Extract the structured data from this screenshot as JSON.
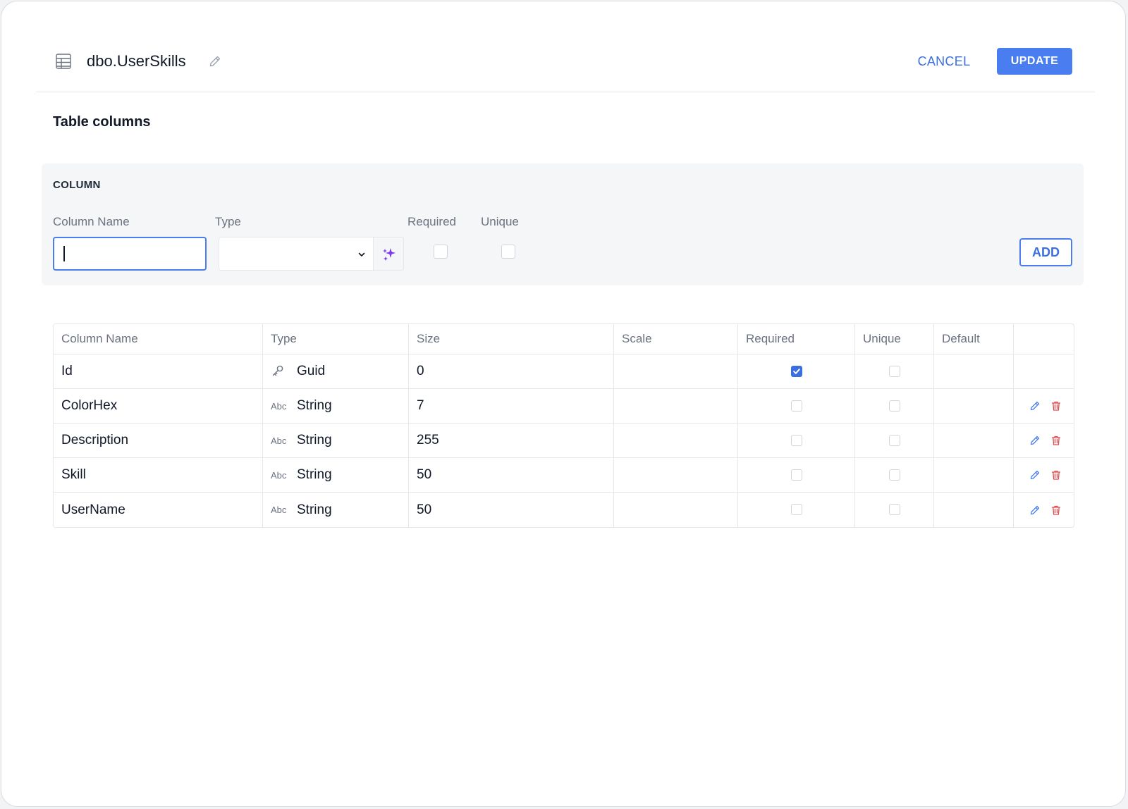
{
  "header": {
    "table_name": "dbo.UserSkills",
    "cancel_label": "CANCEL",
    "update_label": "UPDATE"
  },
  "section_title": "Table columns",
  "add_panel": {
    "heading": "COLUMN",
    "name_label": "Column Name",
    "name_value": "",
    "type_label": "Type",
    "type_value": "",
    "required_label": "Required",
    "unique_label": "Unique",
    "add_label": "ADD"
  },
  "table": {
    "headers": [
      "Column Name",
      "Type",
      "Size",
      "Scale",
      "Required",
      "Unique",
      "Default",
      ""
    ],
    "rows": [
      {
        "name": "Id",
        "type_icon": "key-icon",
        "type": "Guid",
        "size": "0",
        "scale": "",
        "required": true,
        "unique": false,
        "default": "",
        "actions": false
      },
      {
        "name": "ColorHex",
        "type_icon": "abc-icon",
        "type": "String",
        "size": "7",
        "scale": "",
        "required": false,
        "unique": false,
        "default": "",
        "actions": true
      },
      {
        "name": "Description",
        "type_icon": "abc-icon",
        "type": "String",
        "size": "255",
        "scale": "",
        "required": false,
        "unique": false,
        "default": "",
        "actions": true
      },
      {
        "name": "Skill",
        "type_icon": "abc-icon",
        "type": "String",
        "size": "50",
        "scale": "",
        "required": false,
        "unique": false,
        "default": "",
        "actions": true
      },
      {
        "name": "UserName",
        "type_icon": "abc-icon",
        "type": "String",
        "size": "50",
        "scale": "",
        "required": false,
        "unique": false,
        "default": "",
        "actions": true
      }
    ],
    "abc_icon_text": "Abc"
  },
  "colors": {
    "accent": "#4a7df0",
    "accent_text": "#3b6fe0",
    "delete": "#e5484d",
    "magic": "#7c3aed"
  }
}
